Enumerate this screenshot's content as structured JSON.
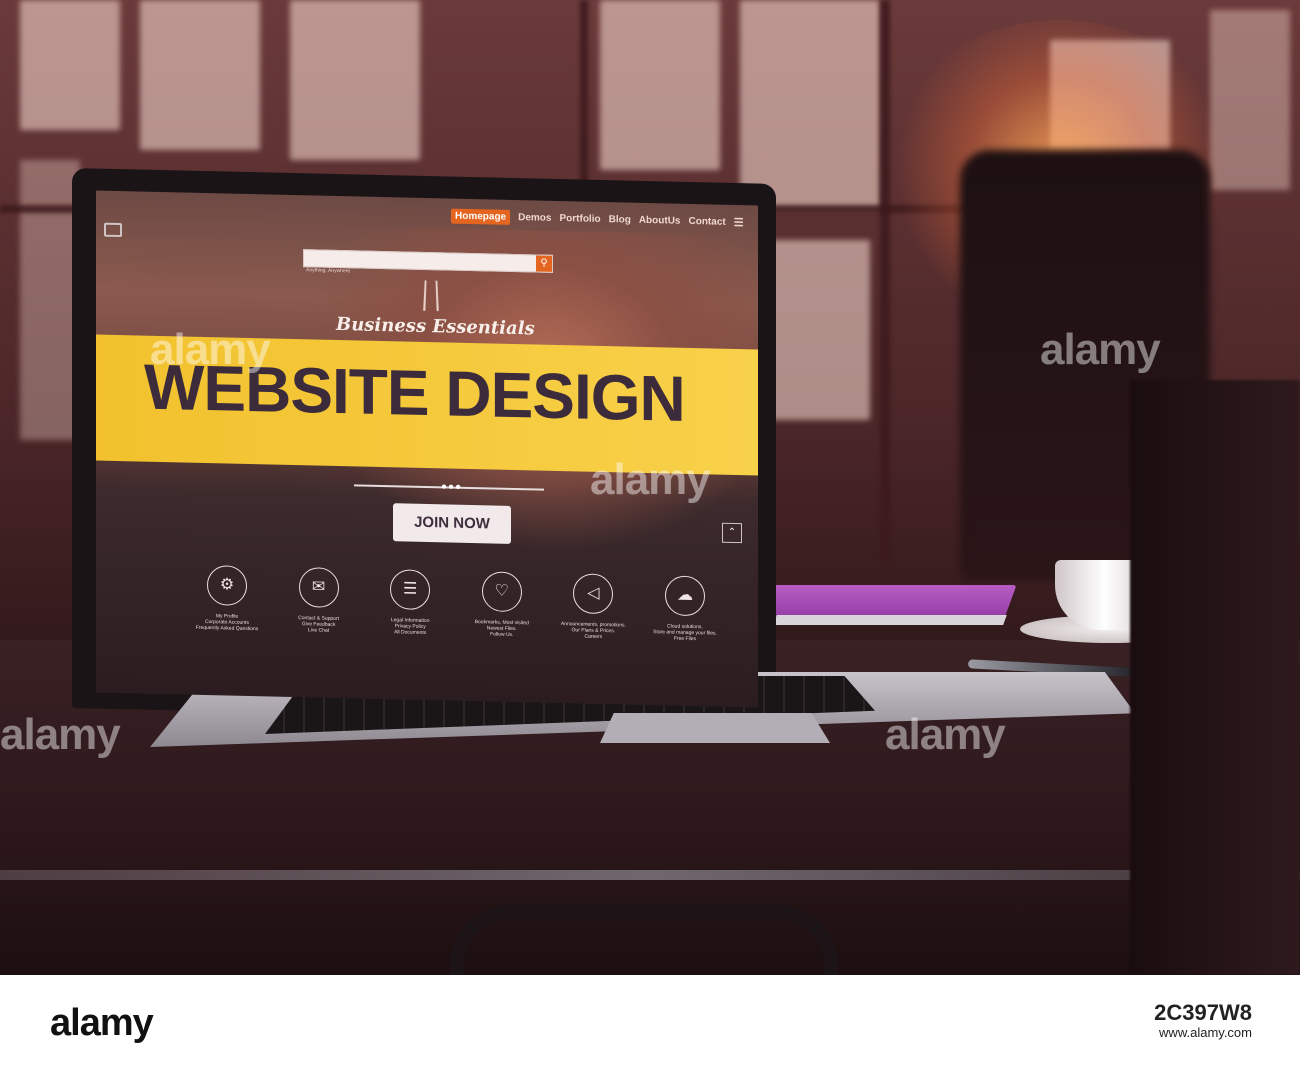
{
  "laptop_screen": {
    "nav": {
      "items": [
        "Homepage",
        "Demos",
        "Portfolio",
        "Blog",
        "AboutUs",
        "Contact"
      ],
      "active_item": "Homepage",
      "menu_icon": "hamburger-menu-icon"
    },
    "search": {
      "hint": "Anything, Anywhere"
    },
    "tagline": "Business Essentials",
    "headline": "WEBSITE DESIGN",
    "cta_label": "JOIN NOW",
    "features": [
      {
        "icon": "gear-icon",
        "text": "My Profile\nCorporate Accounts\nFrequently Asked Questions"
      },
      {
        "icon": "envelope-icon",
        "text": "Contact & Support\nGive Feedback\nLive Chat"
      },
      {
        "icon": "clipboard-icon",
        "text": "Legal Information\nPrivacy Policy\nAll Documents"
      },
      {
        "icon": "heart-icon",
        "text": "Bookmarks, Most visited\nNewest Files.\nFollow Us."
      },
      {
        "icon": "megaphone-icon",
        "text": "Announcements, promotions.\nOur Plans & Prices.\nCareers"
      },
      {
        "icon": "cloud-icon",
        "text": "Cloud solutions.\nStore and manage your files.\nFree Files"
      }
    ],
    "colors": {
      "banner": "#f6c93a",
      "accent": "#e46520",
      "headline": "#3c2b3b"
    }
  },
  "watermark": "alamy",
  "footer": {
    "brand": "alamy",
    "image_id": "2C397W8",
    "site": "www.alamy.com"
  }
}
